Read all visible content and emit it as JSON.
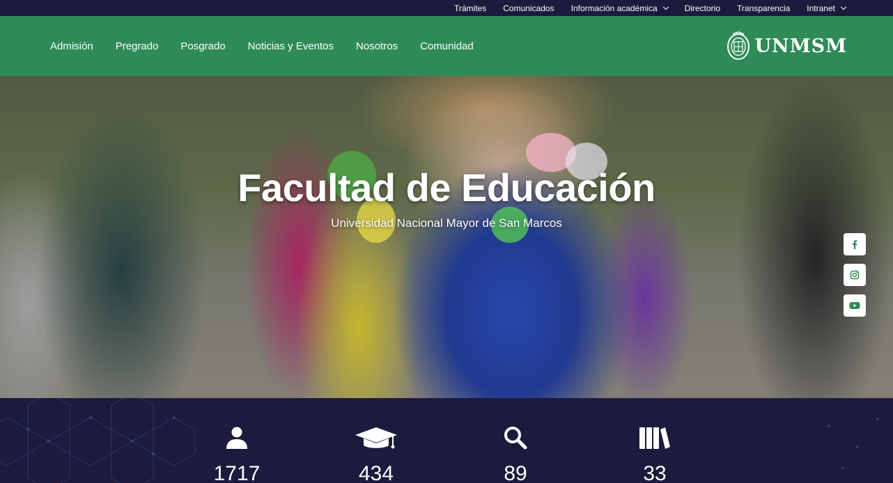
{
  "topbar": {
    "links": [
      {
        "label": "Trámites",
        "dropdown": false
      },
      {
        "label": "Comunicados",
        "dropdown": false
      },
      {
        "label": "Información académica",
        "dropdown": true
      },
      {
        "label": "Directorio",
        "dropdown": false
      },
      {
        "label": "Transparencia",
        "dropdown": false
      },
      {
        "label": "Intranet",
        "dropdown": true
      }
    ]
  },
  "mainnav": {
    "links": [
      "Admisión",
      "Pregrado",
      "Posgrado",
      "Noticias y Eventos",
      "Nosotros",
      "Comunidad"
    ],
    "logo_text": "UNMSM"
  },
  "hero": {
    "title": "Facultad de Educación",
    "subtitle": "Universidad Nacional Mayor de San Marcos"
  },
  "social": [
    "facebook-icon",
    "instagram-icon",
    "youtube-icon"
  ],
  "stats": [
    {
      "icon": "user-icon",
      "value": "1717"
    },
    {
      "icon": "graduation-cap-icon",
      "value": "434"
    },
    {
      "icon": "search-icon",
      "value": "89"
    },
    {
      "icon": "books-icon",
      "value": "33"
    }
  ],
  "colors": {
    "dark": "#1c1a3d",
    "green": "#2e8b57",
    "accent": "#3b5a9b"
  }
}
